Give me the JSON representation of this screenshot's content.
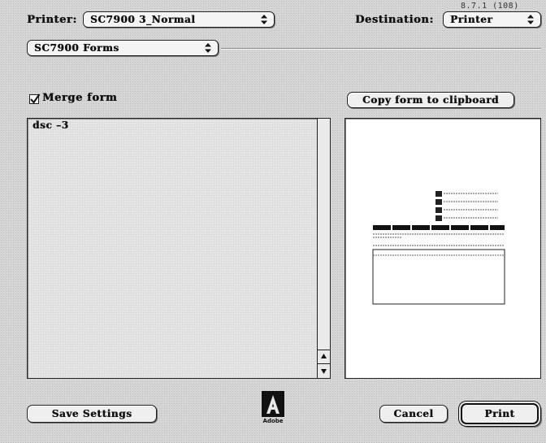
{
  "version": "8.7.1 (108)",
  "printer": {
    "label": "Printer:",
    "value": "SC7900 3_Normal"
  },
  "destination": {
    "label": "Destination:",
    "value": "Printer"
  },
  "section": {
    "value": "SC7900 Forms"
  },
  "merge_form": {
    "label": "Merge form",
    "checked": true
  },
  "copy_button": {
    "label": "Copy form to clipboard"
  },
  "list": {
    "items": [
      "dsc –3"
    ]
  },
  "footer": {
    "save_label": "Save Settings",
    "logo_text": "Adobe",
    "cancel_label": "Cancel",
    "print_label": "Print"
  }
}
